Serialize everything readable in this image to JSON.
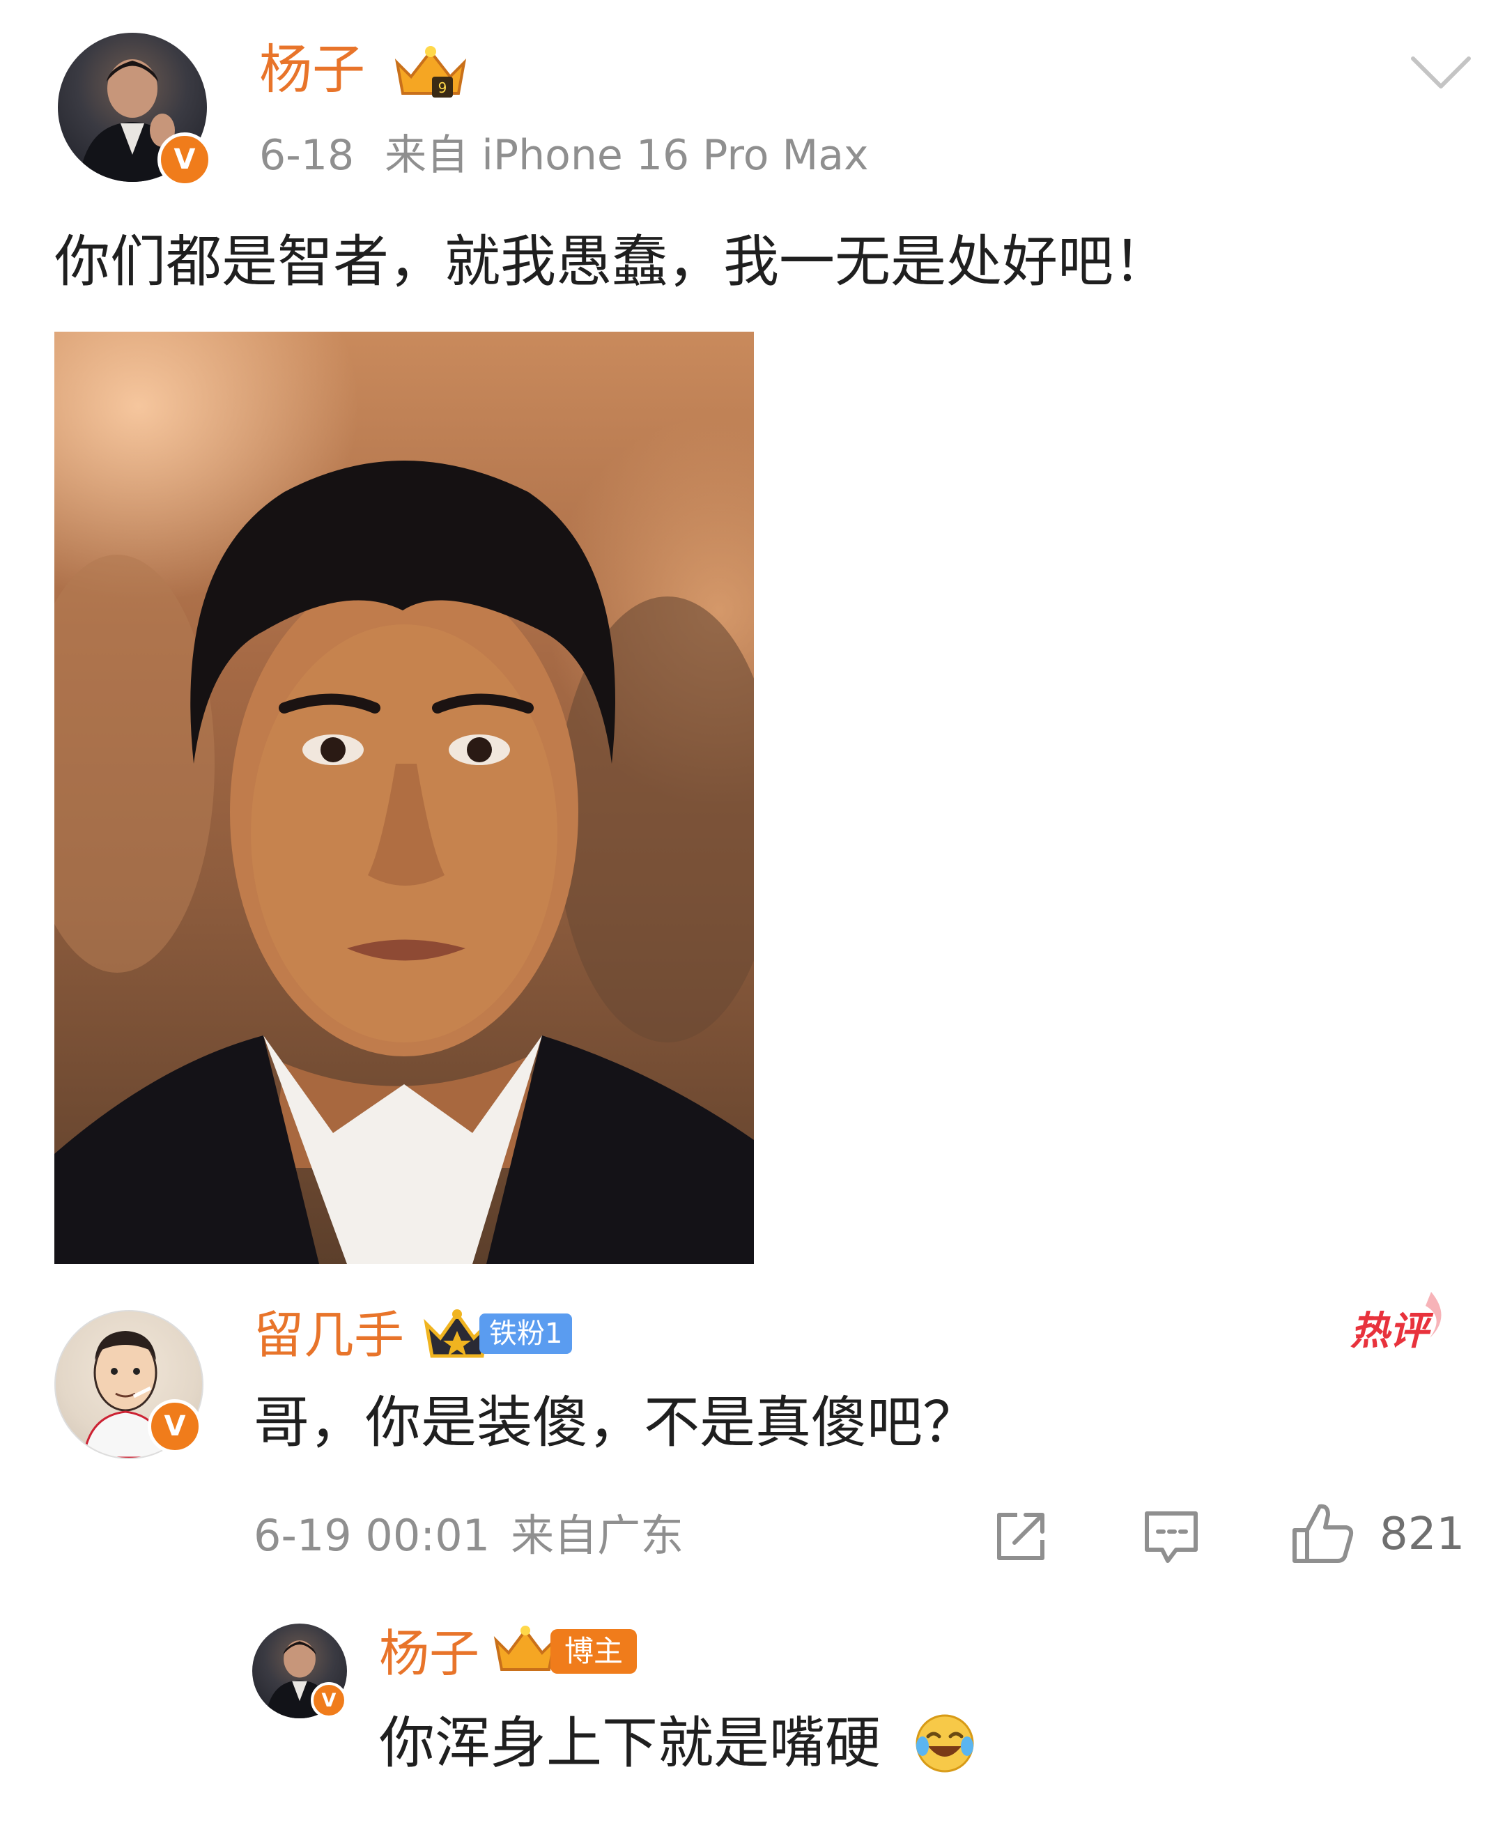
{
  "post": {
    "author_name": "杨子",
    "date": "6-18",
    "source": "来自 iPhone 16 Pro Max",
    "text": "你们都是智者，就我愚蠢，我一无是处好吧！",
    "image_desc_icon": "portrait-photo"
  },
  "comment": {
    "author_name": "留几手",
    "fan_badge": "铁粉1",
    "hot_badge": "热评",
    "text": "哥，你是装傻，不是真傻吧？",
    "time": "6-19 00:01",
    "location": "来自广东",
    "like_count": "821"
  },
  "reply": {
    "author_name": "杨子",
    "author_badge": "博主",
    "text": "你浑身上下就是嘴硬",
    "emoji_icon": "laugh-cry-emoji"
  },
  "colors": {
    "username": "#e8742a",
    "verified_badge": "#f07c1b",
    "fan_badge": "#5a9cf0",
    "hot_red": "#e8323c",
    "meta_gray": "#8f8f8f"
  }
}
